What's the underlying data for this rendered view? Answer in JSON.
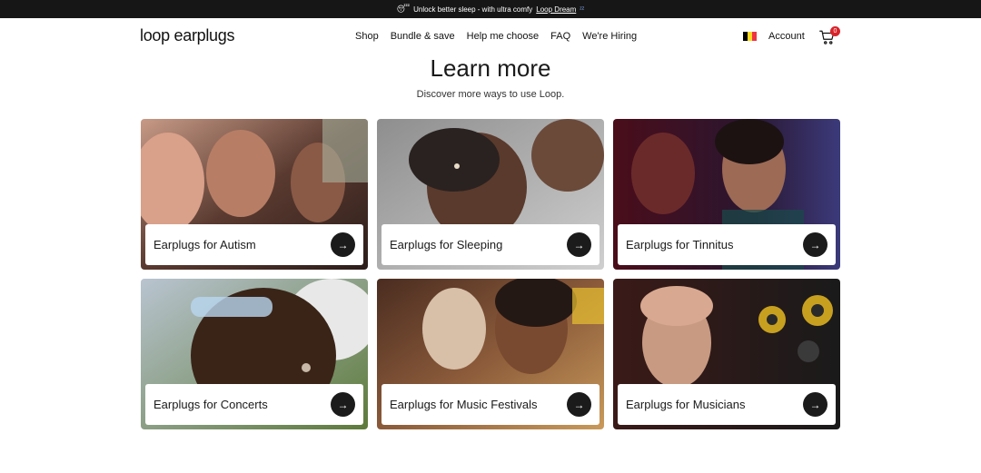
{
  "announcement": {
    "emoji": "😴",
    "text": "Unlock better sleep - with ultra comfy",
    "link": "Loop Dream",
    "suffix": "ᶻᶻ"
  },
  "nav": {
    "logo": "loop earplugs",
    "menu": [
      "Shop",
      "Bundle & save",
      "Help me choose",
      "FAQ",
      "We're Hiring"
    ],
    "account": "Account",
    "cart_count": "0",
    "flag_colors": [
      "#000000",
      "#FDDA24",
      "#EF3340"
    ]
  },
  "section": {
    "title": "Learn more",
    "subtitle": "Discover more ways to use Loop."
  },
  "cards": [
    {
      "label": "Earplugs for Autism",
      "icon": "arrow-right-icon"
    },
    {
      "label": "Earplugs for Sleeping",
      "icon": "arrow-right-icon"
    },
    {
      "label": "Earplugs for Tinnitus",
      "icon": "arrow-right-icon"
    },
    {
      "label": "Earplugs for Concerts",
      "icon": "arrow-right-icon"
    },
    {
      "label": "Earplugs for Music Festivals",
      "icon": "arrow-right-icon"
    },
    {
      "label": "Earplugs for Musicians",
      "icon": "arrow-right-icon"
    }
  ],
  "colors": {
    "announcement_bg": "#161616",
    "cart_badge": "#d8232a",
    "button_bg": "#1b1b1b"
  }
}
